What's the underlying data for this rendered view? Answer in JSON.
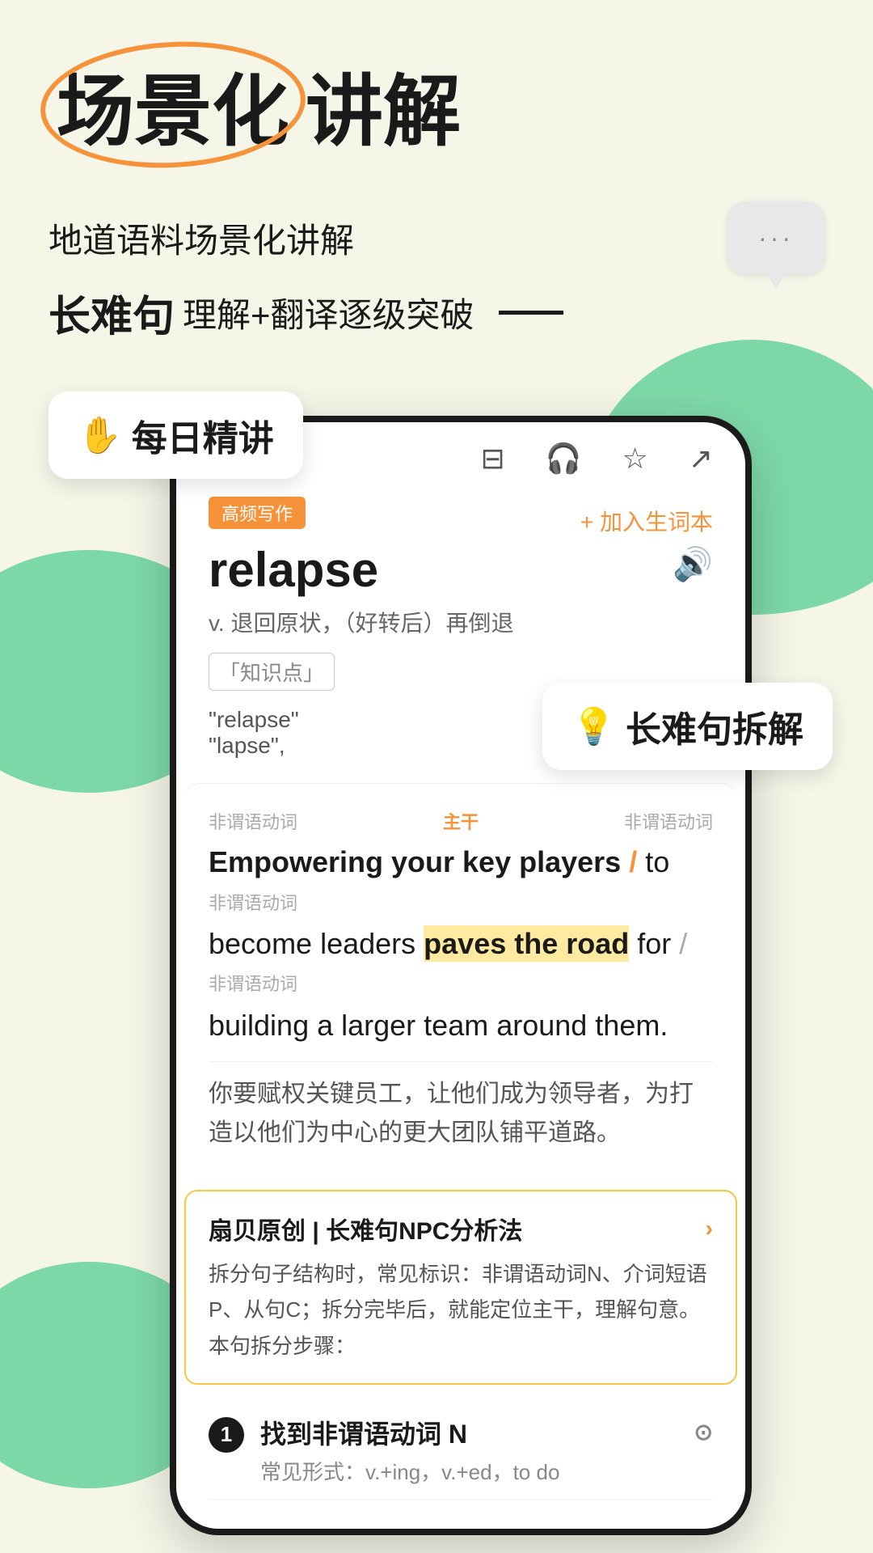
{
  "background_color": "#f5f5e8",
  "header": {
    "title_highlighted": "场景化",
    "title_rest": "讲解",
    "subtitle1": "地道语料场景化讲解",
    "subtitle2_bold": "长难句",
    "subtitle2_rest": "理解+翻译逐级突破"
  },
  "badges": {
    "daily": {
      "emoji": "✋",
      "text": "每日精讲"
    },
    "sentence": {
      "emoji": "💡",
      "text": "长难句拆解"
    }
  },
  "phone": {
    "topbar_icons": [
      "⊟",
      "🎧",
      "☆",
      "↗"
    ],
    "back_icon": "‹",
    "tag": "高频写作",
    "word": "relapse",
    "add_wordbook": "+ 加入生词本",
    "pos": "v. 退回原状，（好转后）再倒退",
    "knowledge_tag": "「知识点」",
    "word_rel_1": "\"relapse\"",
    "word_rel_2": "\"lapse\","
  },
  "sentence_analysis": {
    "grammar_label_left": "非谓语动词",
    "grammar_label_center": "主干",
    "grammar_label_right": "非谓语动词",
    "sentence_part1": "Empowering your key players",
    "slash1": "/",
    "sentence_part2": "to",
    "sentence_part3": "become leaders",
    "highlight_phrase": "paves the road",
    "sentence_part4": "for",
    "slash2": "/",
    "grammar_label_bottom": "非谓语动词",
    "sentence_part5": "building a larger team around them.",
    "translation": "你要赋权关键员工，让他们成为领导者，为打造以他们为中心的更大团队铺平道路。"
  },
  "npc_card": {
    "title": "扇贝原创 | 长难句NPC分析法",
    "arrow": "›",
    "desc": "拆分句子结构时，常见标识：非谓语动词N、介词短语P、从句C；拆分完毕后，就能定位主干，理解句意。\n本句拆分步骤："
  },
  "step": {
    "number": "1",
    "title": "找到非谓语动词 N",
    "target_icon": "⊙",
    "subtitle": "常见形式：v.+ing，v.+ed，to do"
  }
}
